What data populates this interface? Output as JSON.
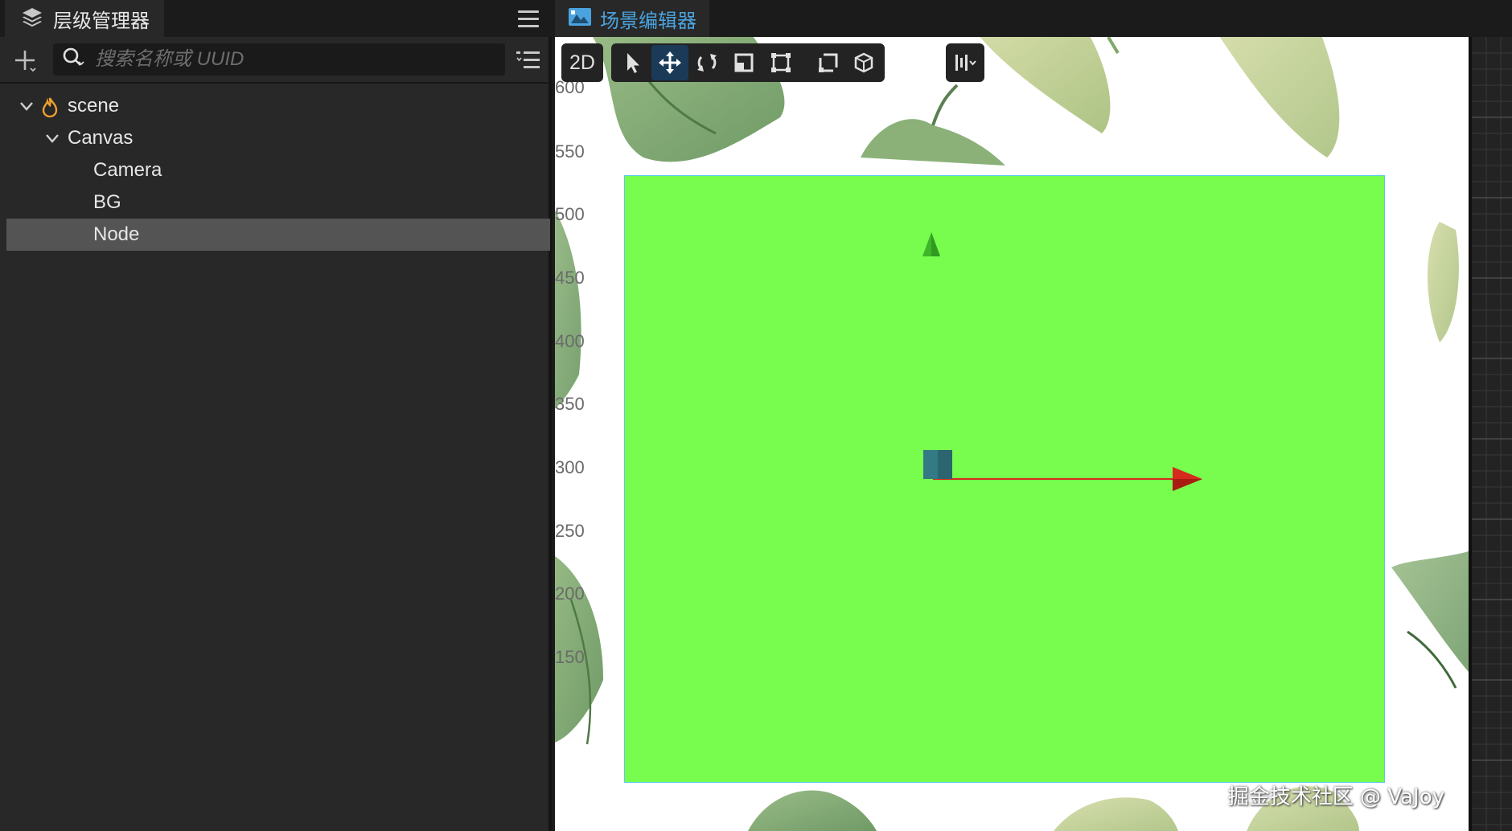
{
  "hierarchy": {
    "tab_title": "层级管理器",
    "search_placeholder": "搜索名称或 UUID",
    "tree": [
      {
        "label": "scene",
        "depth": 0,
        "expanded": true,
        "icon": "fire-icon"
      },
      {
        "label": "Canvas",
        "depth": 1,
        "expanded": true
      },
      {
        "label": "Camera",
        "depth": 2
      },
      {
        "label": "BG",
        "depth": 2
      },
      {
        "label": "Node",
        "depth": 2,
        "selected": true
      }
    ]
  },
  "scene_editor": {
    "tab_title": "场景编辑器",
    "toolbar": {
      "mode_label": "2D",
      "active_tool": "move",
      "tools": [
        "select-tool-icon",
        "move-tool-icon",
        "rotate-tool-icon",
        "scale-tool-icon",
        "rect-tool-icon",
        "magnet-tool-icon",
        "local-pivot-icon",
        "global-space-icon",
        "snap-settings-icon"
      ]
    },
    "ruler_labels": [
      "600",
      "550",
      "500",
      "450",
      "400",
      "350",
      "300",
      "250",
      "200",
      "150"
    ],
    "colors": {
      "rect_fill": "#78fc4e",
      "rect_border": "#59c9e8",
      "gizmo_x": "#d42b1e",
      "gizmo_y": "#3fb52a",
      "gizmo_center": "#347a85",
      "accent": "#4aa3df"
    },
    "watermark": "掘金技术社区 @ VaJoy"
  }
}
